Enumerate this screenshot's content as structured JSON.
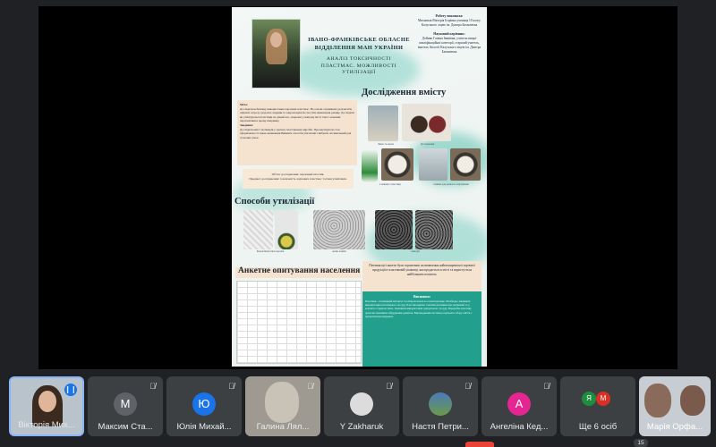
{
  "poster": {
    "title": "ІВАНО-ФРАНКІВСЬКЕ ОБЛАСНЕ ВІДДІЛЕННЯ МАН УКРАЇНИ",
    "subtitle": "АНАЛІЗ ТОКСИЧНОСТІ ПЛАСТМАС. МОЖЛИВОСТІ УТИЛІЗАЦІЇ",
    "author_heading": "Роботу виконала:",
    "author_text": "Миханчак Вікторія Ігорівна учениця 10 класу Калуського ліцею ім. Дмитра Бахматюка",
    "supervisor_heading": "Науковий керівник:",
    "supervisor_text": "Дойняк Галина Іванівна, учитель вищої кваліфікаційної категорії, старший учитель, вчитель біології Калуського ліцею ім. Дмитра Бахматюка",
    "goal_heading": "Мета:",
    "goal_text": "Дослідити небезпеку використання харчових пластмас. На основі отриманих результатів оцінити загрозу здоров'ю людини та запропонувати способи зменшення ризику. Дослідити як утилізуються пластики на даний час, оперечні у нашому місті і які є можливі перспективи в цьому напрямку.",
    "tasks_heading": "Завдання:",
    "tasks_text": "Дослідити вміст полімерів у зразках пластикових виробів. Проаналізувати стан сформованості знань мешканців Вивчити способи утилізації і вибрати оптимальний для сучасних умов",
    "object_text": "Об'єкт дослідження: харчовий пластик.",
    "subject_text": "Предмет дослідження: токсичність харчових пластмас та їхня утилізація.",
    "section_research": "Дослідження вмісту",
    "section_disposal": "Способи утилізації",
    "section_survey": "Анкетне опитування населення",
    "caption_1": "Зміна та аналіз",
    "caption_2": "Дослідження",
    "caption_3": "в пляшці з пластику",
    "caption_4": "пляшка для дитячого харчування",
    "caption_5": "Pseudoflexus microsporum",
    "caption_6": "Aedes termite",
    "caption_7": "бактерії",
    "survey_note": "Питання цієї анкети були спрямовані на виявлення найпоширенішої харчової продукції в пластиковій упаковці, яка продається в місті та користується найбільшим попитом.",
    "conclusions_heading": "Висновки:",
    "conclusions_text": "Пластики – полімерний матеріал з поліпропіленом на основі вуглецю. Необхідно зменшити використання пластикового посуду. Пластик виділяє токсичні речовини при нагріванні та у контакті з гарячою їжею. Зменшити використання одноразового посуду. Переробка пластику дозволяє зменшити забруднення довкілля. Впровадження системи роздільного збору сміття є пріоритетним напрямом."
  },
  "participants": [
    {
      "name": "Вікторія Мих...",
      "initial": "",
      "color": "#5f6368",
      "mic": "speaking"
    },
    {
      "name": "Максим Ста...",
      "initial": "М",
      "color": "#5f6368",
      "mic": "muted"
    },
    {
      "name": "Юлія Михай...",
      "initial": "Ю",
      "color": "#1a73e8",
      "mic": "muted"
    },
    {
      "name": "Галина Лял...",
      "initial": "",
      "color": "#8a8a8a",
      "mic": "muted"
    },
    {
      "name": "Y Zakharuk",
      "initial": "",
      "color": "#5f6368",
      "mic": "muted"
    },
    {
      "name": "Настя Петри...",
      "initial": "",
      "color": "#5f6368",
      "mic": "muted"
    },
    {
      "name": "Ангеліна Кед...",
      "initial": "А",
      "color": "#e52592",
      "mic": "muted"
    },
    {
      "name": "Ще 6 осіб",
      "initials": [
        "Я",
        "М"
      ],
      "colors": [
        "#1e8e3e",
        "#d93025"
      ],
      "mic": ""
    },
    {
      "name": "Марія Орфа...",
      "initial": "",
      "color": "#6d6d6d",
      "mic": ""
    }
  ],
  "overflow_count": "15"
}
